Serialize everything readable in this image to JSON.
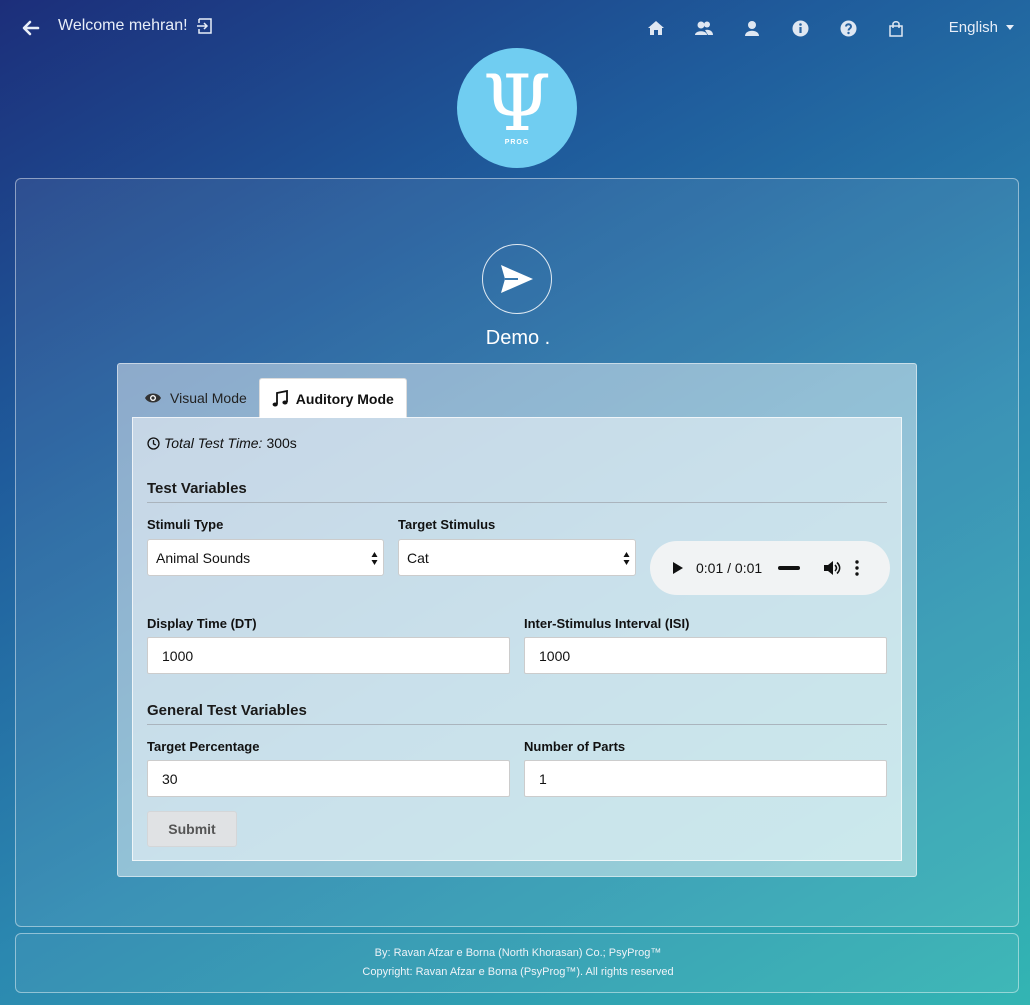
{
  "header": {
    "welcome": "Welcome mehran!",
    "language": "English",
    "nav_icons": [
      "home-icon",
      "users-icon",
      "user-icon",
      "info-icon",
      "help-icon",
      "shop-icon"
    ]
  },
  "logo": {
    "symbol": "Ψ",
    "text": "PROG"
  },
  "page": {
    "title": "Demo ."
  },
  "tabs": [
    {
      "label": "Visual Mode",
      "icon": "eye-icon",
      "active": false
    },
    {
      "label": "Auditory Mode",
      "icon": "music-icon",
      "active": true
    }
  ],
  "total_time": {
    "label": "Total Test Time:",
    "value": "300s"
  },
  "sections": {
    "test_variables": "Test Variables",
    "general_test_variables": "General Test Variables"
  },
  "fields": {
    "stimuli_type": {
      "label": "Stimuli Type",
      "value": "Animal Sounds"
    },
    "target_stimulus": {
      "label": "Target Stimulus",
      "value": "Cat"
    },
    "display_time": {
      "label": "Display Time (DT)",
      "value": "1000"
    },
    "isi": {
      "label": "Inter-Stimulus Interval (ISI)",
      "value": "1000"
    },
    "target_percentage": {
      "label": "Target Percentage",
      "value": "30"
    },
    "number_of_parts": {
      "label": "Number of Parts",
      "value": "1"
    }
  },
  "audio": {
    "time": "0:01 / 0:01"
  },
  "submit_label": "Submit",
  "footer": {
    "line1": "By: Ravan Afzar e Borna (North Khorasan) Co.; PsyProg™",
    "line2": "Copyright: Ravan Afzar e Borna (PsyProg™). All rights reserved"
  },
  "colors": {
    "logo_bg": "#70cdf1",
    "bg_start": "#1c2e7a",
    "bg_end": "#33b5b3"
  }
}
